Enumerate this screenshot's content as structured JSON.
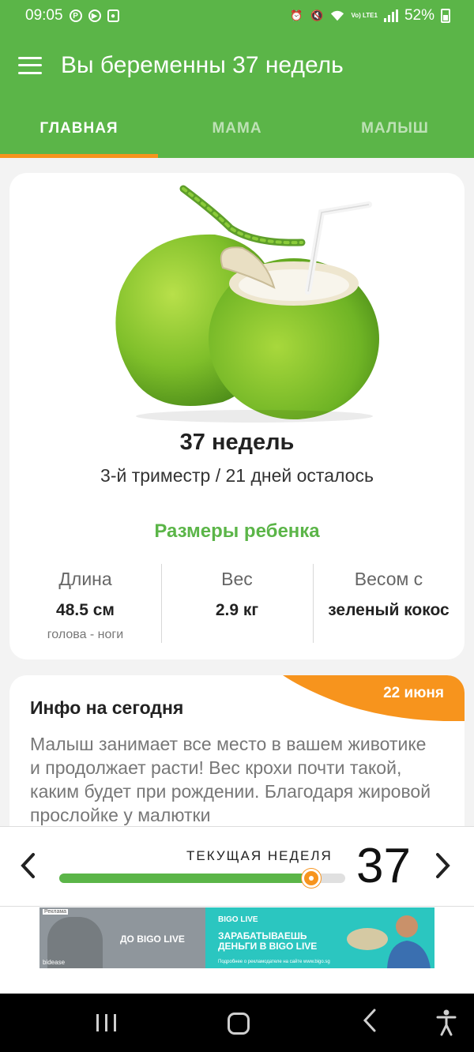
{
  "status_bar": {
    "time": "09:05",
    "battery": "52%",
    "lte_label": "Vo) LTE1",
    "icons": [
      "pinterest-icon",
      "play-icon",
      "notification-square-icon",
      "alarm-icon",
      "mute-icon",
      "wifi-icon",
      "signal-icon",
      "battery-icon"
    ]
  },
  "app_bar": {
    "title": "Вы беременны 37 недель"
  },
  "tabs": [
    {
      "label": "ГЛАВНАЯ",
      "active": true
    },
    {
      "label": "МАМА",
      "active": false
    },
    {
      "label": "МАЛЫШ",
      "active": false
    }
  ],
  "week_card": {
    "title": "37 недель",
    "subtitle": "3-й триместр / 21 дней осталось",
    "sizes_title": "Размеры ребенка",
    "stats": [
      {
        "label": "Длина",
        "value": "48.5 см",
        "note": "голова - ноги"
      },
      {
        "label": "Вес",
        "value": "2.9 кг",
        "note": ""
      },
      {
        "label": "Весом с",
        "value": "зеленый кокос",
        "note": ""
      }
    ]
  },
  "info_card": {
    "date": "22 июня",
    "title": "Инфо на сегодня",
    "body": "Малыш занимает все место в вашем животике и продолжает расти! Вес крохи почти такой, каким будет при рождении. Благодаря жировой прослойке у малютки"
  },
  "week_selector": {
    "label": "ТЕКУЩАЯ НЕДЕЛЯ",
    "week": "37",
    "progress": 0.88,
    "prev_icon": "chevron-left-icon",
    "next_icon": "chevron-right-icon"
  },
  "ad": {
    "tag": "Реклама",
    "left_text": "ДО BIGO LIVE",
    "brand_small": "bidease",
    "logo": "BIGO LIVE",
    "headline": "ЗАРАБАТЫВАЕШЬ ДЕНЬГИ В BIGO LIVE",
    "small": "Подробнее о рекламодателе на сайте www.bigo.sg"
  },
  "colors": {
    "primary": "#5bb548",
    "accent": "#f7941d"
  }
}
